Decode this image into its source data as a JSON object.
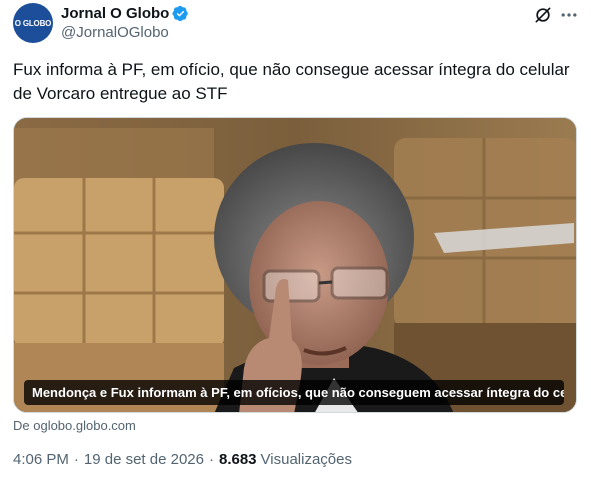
{
  "account": {
    "avatar_text": "O GLOBO",
    "display_name": "Jornal O Globo",
    "handle": "@JornalOGlobo",
    "verified_color": "#1d9bf0"
  },
  "icons": {
    "grok": "grok-icon",
    "more": "more-icon"
  },
  "tweet": {
    "text": "Fux informa à PF, em ofício, que não consegue acessar íntegra do celular de Vorcaro entregue ao STF"
  },
  "media": {
    "caption": "Mendonça e Fux informam à PF, em ofícios, que não conseguem acessar íntegra do cel..."
  },
  "source": {
    "text": "De oglobo.globo.com"
  },
  "meta": {
    "time": "4:06 PM",
    "separator": "·",
    "date": "19 de set de 2026",
    "views_count": "8.683",
    "views_label": "Visualizações"
  }
}
